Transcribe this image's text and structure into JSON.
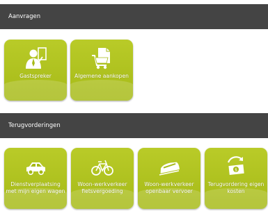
{
  "sections": {
    "aanvragen": {
      "title": "Aanvragen",
      "tiles": [
        {
          "label": "Gastspreker",
          "icon": "speaker-person-icon"
        },
        {
          "label": "Algemene aankopen",
          "icon": "shopping-cart-document-icon"
        }
      ]
    },
    "terugvorderingen": {
      "title": "Terugvorderingen",
      "tiles": [
        {
          "label": "Dienstverplaatsing met mijn eigen wagen",
          "icon": "car-icon"
        },
        {
          "label": "Woon-werkverkeer fietsvergoeding",
          "icon": "bicycle-icon"
        },
        {
          "label": "Woon-werkverkeer openbaar vervoer",
          "icon": "train-icon"
        },
        {
          "label": "Terugvordering eigen kosten",
          "icon": "money-return-icon"
        }
      ]
    }
  },
  "colors": {
    "header_bg": "#444444",
    "tile_green": "#b0c220",
    "text": "#ffffff"
  }
}
